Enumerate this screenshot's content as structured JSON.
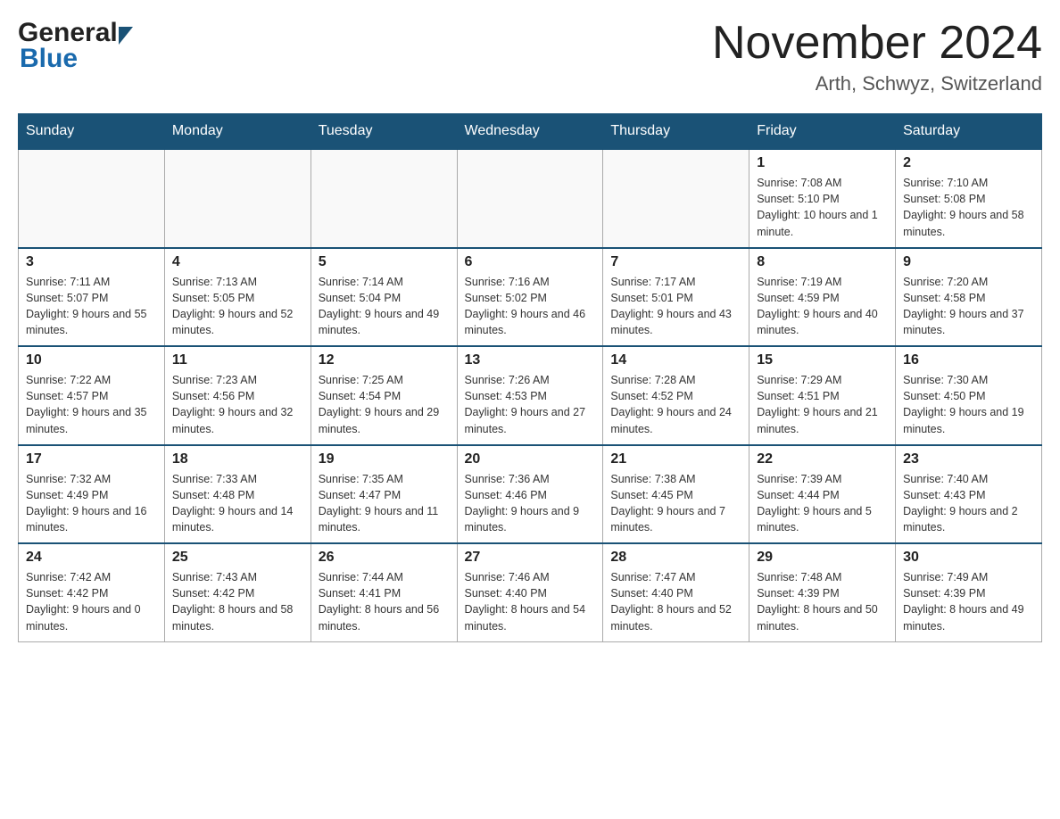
{
  "header": {
    "logo_general": "General",
    "logo_blue": "Blue",
    "month_title": "November 2024",
    "location": "Arth, Schwyz, Switzerland"
  },
  "days_of_week": [
    "Sunday",
    "Monday",
    "Tuesday",
    "Wednesday",
    "Thursday",
    "Friday",
    "Saturday"
  ],
  "weeks": [
    [
      {
        "day": "",
        "info": ""
      },
      {
        "day": "",
        "info": ""
      },
      {
        "day": "",
        "info": ""
      },
      {
        "day": "",
        "info": ""
      },
      {
        "day": "",
        "info": ""
      },
      {
        "day": "1",
        "info": "Sunrise: 7:08 AM\nSunset: 5:10 PM\nDaylight: 10 hours and 1 minute."
      },
      {
        "day": "2",
        "info": "Sunrise: 7:10 AM\nSunset: 5:08 PM\nDaylight: 9 hours and 58 minutes."
      }
    ],
    [
      {
        "day": "3",
        "info": "Sunrise: 7:11 AM\nSunset: 5:07 PM\nDaylight: 9 hours and 55 minutes."
      },
      {
        "day": "4",
        "info": "Sunrise: 7:13 AM\nSunset: 5:05 PM\nDaylight: 9 hours and 52 minutes."
      },
      {
        "day": "5",
        "info": "Sunrise: 7:14 AM\nSunset: 5:04 PM\nDaylight: 9 hours and 49 minutes."
      },
      {
        "day": "6",
        "info": "Sunrise: 7:16 AM\nSunset: 5:02 PM\nDaylight: 9 hours and 46 minutes."
      },
      {
        "day": "7",
        "info": "Sunrise: 7:17 AM\nSunset: 5:01 PM\nDaylight: 9 hours and 43 minutes."
      },
      {
        "day": "8",
        "info": "Sunrise: 7:19 AM\nSunset: 4:59 PM\nDaylight: 9 hours and 40 minutes."
      },
      {
        "day": "9",
        "info": "Sunrise: 7:20 AM\nSunset: 4:58 PM\nDaylight: 9 hours and 37 minutes."
      }
    ],
    [
      {
        "day": "10",
        "info": "Sunrise: 7:22 AM\nSunset: 4:57 PM\nDaylight: 9 hours and 35 minutes."
      },
      {
        "day": "11",
        "info": "Sunrise: 7:23 AM\nSunset: 4:56 PM\nDaylight: 9 hours and 32 minutes."
      },
      {
        "day": "12",
        "info": "Sunrise: 7:25 AM\nSunset: 4:54 PM\nDaylight: 9 hours and 29 minutes."
      },
      {
        "day": "13",
        "info": "Sunrise: 7:26 AM\nSunset: 4:53 PM\nDaylight: 9 hours and 27 minutes."
      },
      {
        "day": "14",
        "info": "Sunrise: 7:28 AM\nSunset: 4:52 PM\nDaylight: 9 hours and 24 minutes."
      },
      {
        "day": "15",
        "info": "Sunrise: 7:29 AM\nSunset: 4:51 PM\nDaylight: 9 hours and 21 minutes."
      },
      {
        "day": "16",
        "info": "Sunrise: 7:30 AM\nSunset: 4:50 PM\nDaylight: 9 hours and 19 minutes."
      }
    ],
    [
      {
        "day": "17",
        "info": "Sunrise: 7:32 AM\nSunset: 4:49 PM\nDaylight: 9 hours and 16 minutes."
      },
      {
        "day": "18",
        "info": "Sunrise: 7:33 AM\nSunset: 4:48 PM\nDaylight: 9 hours and 14 minutes."
      },
      {
        "day": "19",
        "info": "Sunrise: 7:35 AM\nSunset: 4:47 PM\nDaylight: 9 hours and 11 minutes."
      },
      {
        "day": "20",
        "info": "Sunrise: 7:36 AM\nSunset: 4:46 PM\nDaylight: 9 hours and 9 minutes."
      },
      {
        "day": "21",
        "info": "Sunrise: 7:38 AM\nSunset: 4:45 PM\nDaylight: 9 hours and 7 minutes."
      },
      {
        "day": "22",
        "info": "Sunrise: 7:39 AM\nSunset: 4:44 PM\nDaylight: 9 hours and 5 minutes."
      },
      {
        "day": "23",
        "info": "Sunrise: 7:40 AM\nSunset: 4:43 PM\nDaylight: 9 hours and 2 minutes."
      }
    ],
    [
      {
        "day": "24",
        "info": "Sunrise: 7:42 AM\nSunset: 4:42 PM\nDaylight: 9 hours and 0 minutes."
      },
      {
        "day": "25",
        "info": "Sunrise: 7:43 AM\nSunset: 4:42 PM\nDaylight: 8 hours and 58 minutes."
      },
      {
        "day": "26",
        "info": "Sunrise: 7:44 AM\nSunset: 4:41 PM\nDaylight: 8 hours and 56 minutes."
      },
      {
        "day": "27",
        "info": "Sunrise: 7:46 AM\nSunset: 4:40 PM\nDaylight: 8 hours and 54 minutes."
      },
      {
        "day": "28",
        "info": "Sunrise: 7:47 AM\nSunset: 4:40 PM\nDaylight: 8 hours and 52 minutes."
      },
      {
        "day": "29",
        "info": "Sunrise: 7:48 AM\nSunset: 4:39 PM\nDaylight: 8 hours and 50 minutes."
      },
      {
        "day": "30",
        "info": "Sunrise: 7:49 AM\nSunset: 4:39 PM\nDaylight: 8 hours and 49 minutes."
      }
    ]
  ]
}
